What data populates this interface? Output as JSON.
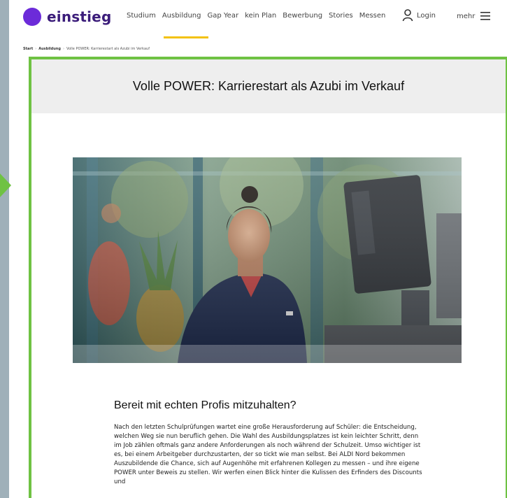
{
  "header": {
    "logo_text": "einstieg",
    "nav_items": [
      "Studium",
      "Ausbildung",
      "Gap Year",
      "kein Plan",
      "Bewerbung",
      "Stories",
      "Messen"
    ],
    "login_label": "Login",
    "more_label": "mehr",
    "icons": [
      "user-icon",
      "menu-icon"
    ]
  },
  "breadcrumb": {
    "items": [
      "Start",
      "Ausbildung",
      "Volle POWER: Karrierestart als Azubi im Verkauf"
    ]
  },
  "article": {
    "title": "Volle POWER: Karrierestart als Azubi im Verkauf",
    "section_heading": "Bereit mit echten Profis mitzuhalten?",
    "body": "Nach den letzten Schulprüfungen wartet eine große Herausforderung auf Schüler: die Entscheidung, welchen Weg sie nun beruflich gehen. Die Wahl des Ausbildungsplatzes ist kein leichter Schritt, denn im Job zählen oftmals ganz andere Anforderungen als noch während der Schulzeit. Umso wichtiger ist es, bei einem Arbeitgeber durchzustarten, der so tickt wie man selbst. Bei ALDI Nord bekommen Auszubildende die Chance, sich auf Augenhöhe mit erfahrenen Kollegen zu messen – und ihre eigene POWER unter Beweis zu stellen. Wir werfen einen Blick hinter die Kulissen des Erfinders des Discounts und"
  },
  "colors": {
    "brand_purple": "#6c2bd9",
    "accent_yellow": "#f3c20f",
    "highlight_green": "#6fc243"
  }
}
